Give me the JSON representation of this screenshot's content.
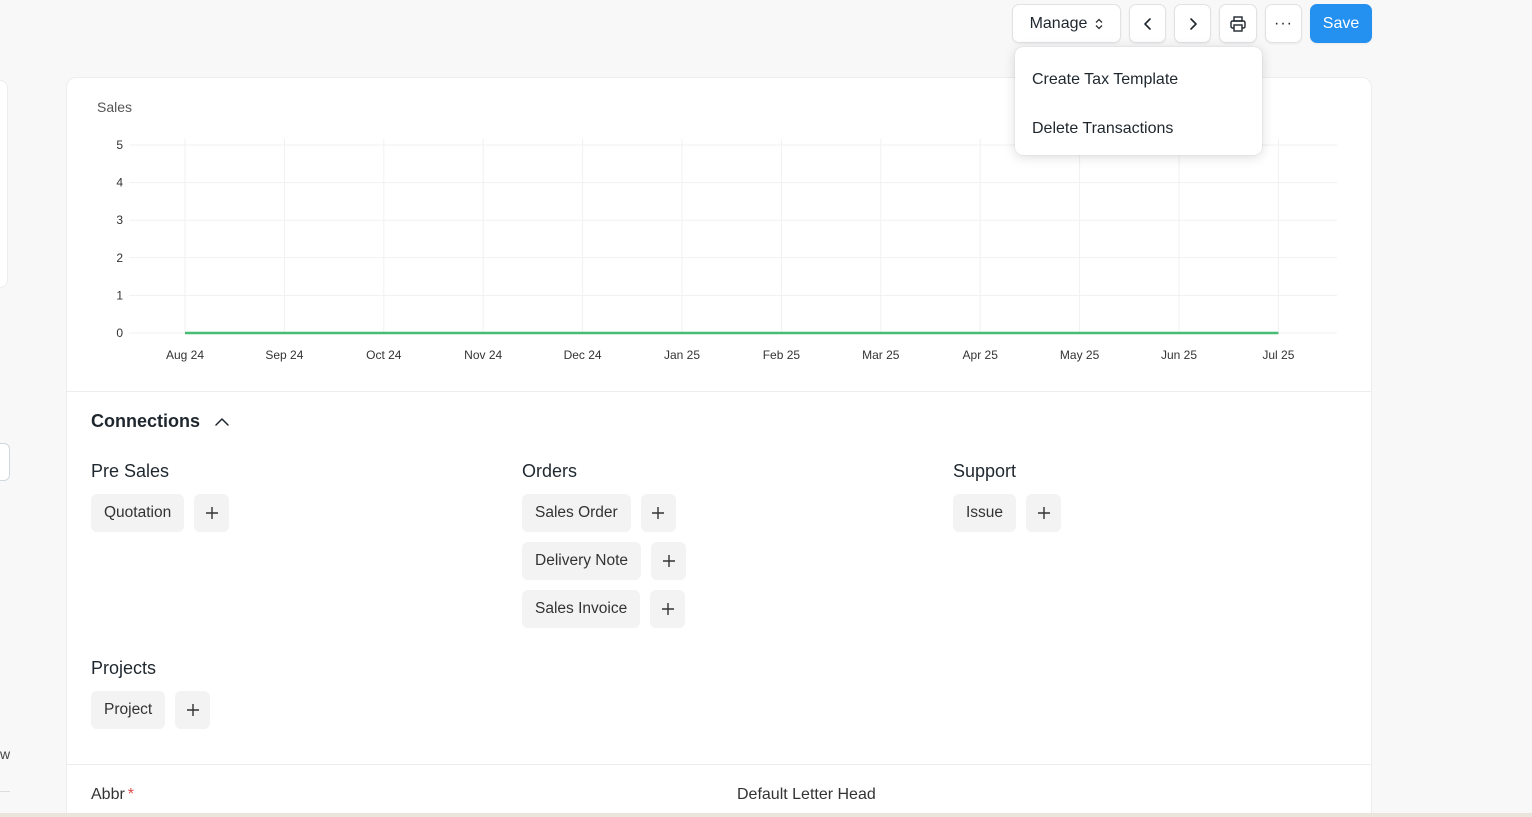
{
  "toolbar": {
    "manage_label": "Manage",
    "more_label": "···",
    "save_label": "Save"
  },
  "dropdown": {
    "items": [
      {
        "label": "Create Tax Template"
      },
      {
        "label": "Delete Transactions"
      }
    ]
  },
  "left_edge": {
    "letter": "w"
  },
  "chart_data": {
    "type": "line",
    "title": "Sales",
    "categories": [
      "Aug 24",
      "Sep 24",
      "Oct 24",
      "Nov 24",
      "Dec 24",
      "Jan 25",
      "Feb 25",
      "Mar 25",
      "Apr 25",
      "May 25",
      "Jun 25",
      "Jul 25"
    ],
    "series": [
      {
        "values": [
          0,
          0,
          0,
          0,
          0,
          0,
          0,
          0,
          0,
          0,
          0,
          0
        ],
        "color": "#48bb74"
      }
    ],
    "ylim": [
      0,
      5
    ],
    "yticks": [
      0,
      1,
      2,
      3,
      4,
      5
    ],
    "grid": true
  },
  "connections": {
    "title": "Connections",
    "groups": [
      {
        "title": "Pre Sales",
        "docs": [
          "Quotation"
        ]
      },
      {
        "title": "Orders",
        "docs": [
          "Sales Order",
          "Delivery Note",
          "Sales Invoice"
        ]
      },
      {
        "title": "Support",
        "docs": [
          "Issue"
        ]
      },
      {
        "title": "Projects",
        "docs": [
          "Project"
        ]
      }
    ]
  },
  "fields": {
    "abbr_label": "Abbr",
    "abbr_required": "*",
    "letter_head_label": "Default Letter Head"
  }
}
